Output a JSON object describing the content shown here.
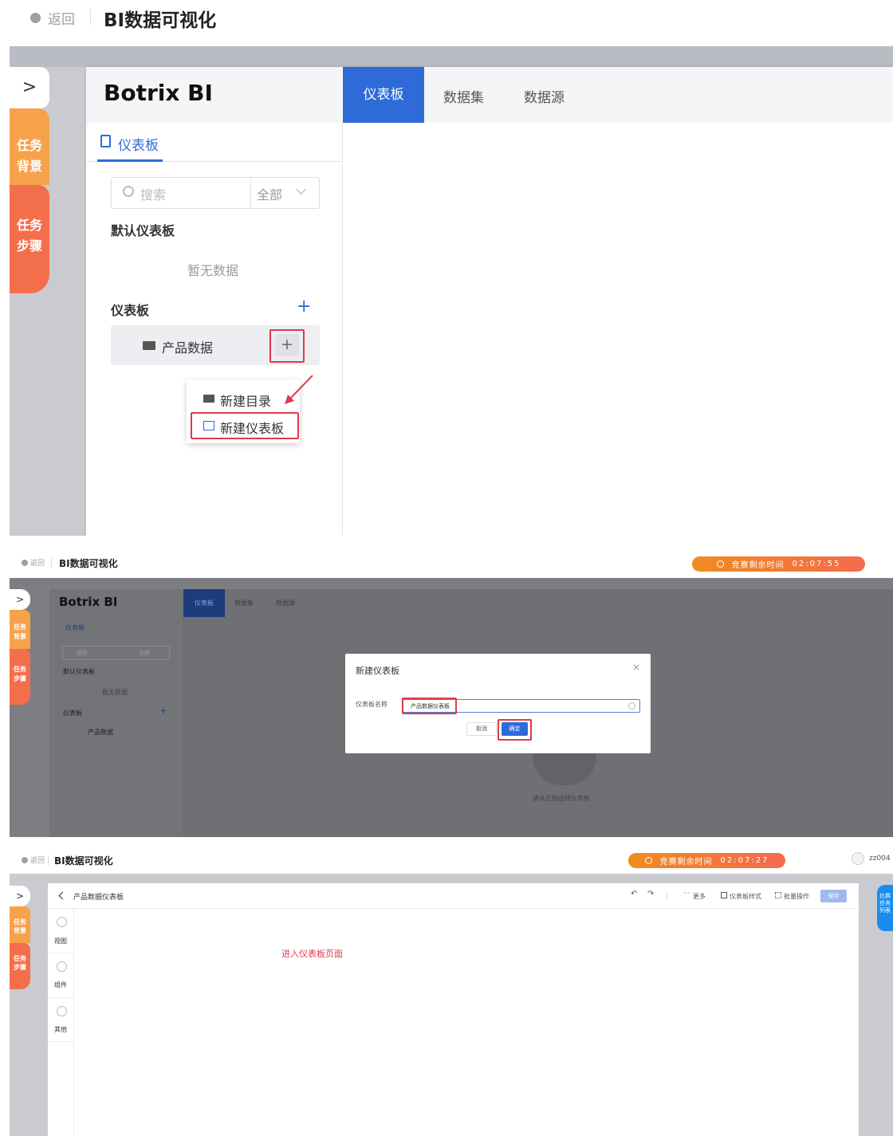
{
  "common": {
    "back_label": "返回",
    "app_title": "BI数据可视化",
    "task_bg": "任务背景",
    "task_steps": "任务步骤",
    "brand": "Botrix BI",
    "tabs": [
      "仪表板",
      "数据集",
      "数据源"
    ],
    "timer_label": "竞赛剩余时间",
    "accent": "#2254d6",
    "timer_color": "#f0871f"
  },
  "panel1": {
    "subtab": "仪表板",
    "search_placeholder": "搜索",
    "filter": "全部",
    "default_section": "默认仪表板",
    "empty": "暂无数据",
    "section": "仪表板",
    "folder": "产品数据",
    "menu": [
      "新建目录",
      "新建仪表板"
    ]
  },
  "panel2": {
    "timer_value": "02:07:55",
    "subtab": "仪表板",
    "search_placeholder": "搜索",
    "filter": "全部",
    "default_section": "默认仪表板",
    "empty": "暂无数据",
    "section": "仪表板",
    "folder": "产品数据",
    "dialog_title": "新建仪表板",
    "field_label": "仪表板名称",
    "field_value": "产品数据仪表板",
    "cancel": "取消",
    "confirm": "确定",
    "hint": "请从左侧选择仪表板"
  },
  "panel3": {
    "timer_value": "02:07:27",
    "user": "zz004",
    "dashboard_title": "产品数据仪表板",
    "toolbar": [
      "更多",
      "仪表板样式",
      "批量操作"
    ],
    "save": "保存",
    "rail": [
      "视图",
      "组件",
      "其他"
    ],
    "annotation": "进入仪表板页面",
    "right_tab": "比赛任务列表"
  }
}
